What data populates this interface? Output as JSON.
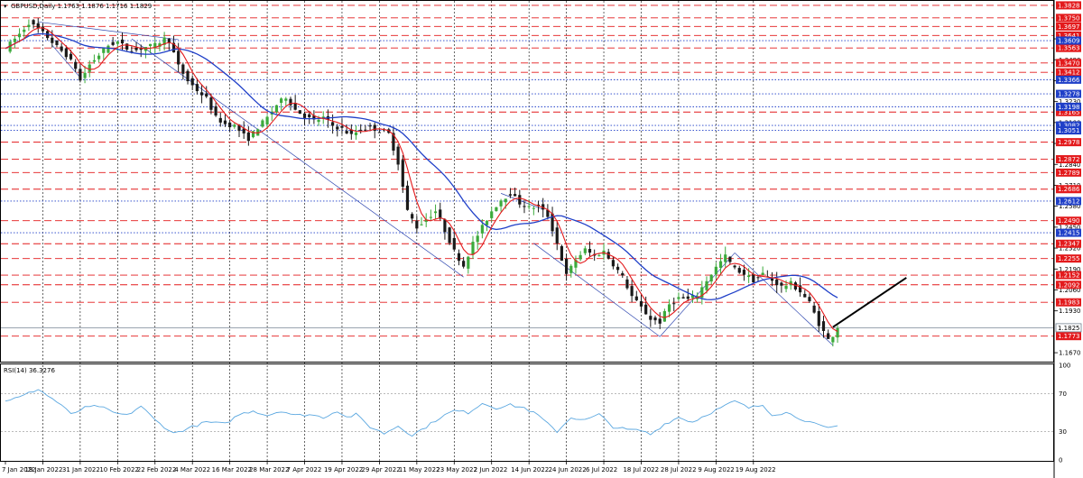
{
  "header": {
    "symbol_info": "GBPUSD,Daily  1.1763 1.1876 1.1716 1.1829",
    "rsi_title": "RSI(14) 36.3276"
  },
  "colors": {
    "bull": "#3caa3c",
    "bear": "#1a1a1a",
    "ma_fast": "#e31a1c",
    "ma_slow": "#1f3fc8",
    "resistance": "#e31a1c",
    "support_dotted": "#1f3fc8",
    "rsi_line": "#5aa7e0",
    "current_price": "#5f6f80"
  },
  "chart_data": {
    "type": "candlestick",
    "ylim": [
      1.162,
      1.385
    ],
    "price_axis_ticks": [
      "1.1670",
      "1.1930",
      "1.2060",
      "1.2190",
      "1.2320",
      "1.2450",
      "1.2580",
      "1.2710",
      "1.2840",
      "1.2970",
      "1.3100",
      "1.3230",
      "1.3360",
      "1.3490",
      "1.3620"
    ],
    "date_labels": [
      "7 Jan 2022",
      "19 Jan 2022",
      "31 Jan 2022",
      "10 Feb 2022",
      "22 Feb 2022",
      "4 Mar 2022",
      "16 Mar 2022",
      "28 Mar 2022",
      "7 Apr 2022",
      "19 Apr 2022",
      "29 Apr 2022",
      "11 May 2022",
      "23 May 2022",
      "2 Jun 2022",
      "14 Jun 2022",
      "24 Jun 2022",
      "6 Jul 2022",
      "18 Jul 2022",
      "28 Jul 2022",
      "9 Aug 2022",
      "19 Aug 2022"
    ],
    "current_price": "1.1825",
    "red_levels": [
      "1.3828",
      "1.3750",
      "1.3697",
      "1.3641",
      "1.3563",
      "1.3470",
      "1.3412",
      "1.3165",
      "1.2978",
      "1.2872",
      "1.2789",
      "1.2686",
      "1.2490",
      "1.2347",
      "1.2255",
      "1.2152",
      "1.2092",
      "1.1983",
      "1.1773"
    ],
    "blue_levels": [
      "1.3609",
      "1.3366",
      "1.3278",
      "1.3198",
      "1.3082",
      "1.3051",
      "1.2612",
      "1.2415"
    ],
    "rsi": {
      "title": "RSI(14) 36.3276",
      "ylim": [
        0,
        100
      ],
      "ticks": [
        "100",
        "70",
        "30",
        "0"
      ],
      "levels": [
        70,
        30
      ],
      "anchors": [
        [
          0,
          63
        ],
        [
          3,
          66
        ],
        [
          7,
          75
        ],
        [
          9,
          68
        ],
        [
          12,
          58
        ],
        [
          14,
          48
        ],
        [
          17,
          55
        ],
        [
          20,
          57
        ],
        [
          23,
          50
        ],
        [
          26,
          47
        ],
        [
          29,
          57
        ],
        [
          32,
          42
        ],
        [
          36,
          28
        ],
        [
          40,
          35
        ],
        [
          43,
          40
        ],
        [
          47,
          38
        ],
        [
          50,
          48
        ],
        [
          53,
          52
        ],
        [
          56,
          47
        ],
        [
          59,
          52
        ],
        [
          62,
          47
        ],
        [
          65,
          48
        ],
        [
          68,
          45
        ],
        [
          71,
          52
        ],
        [
          73,
          45
        ],
        [
          75,
          48
        ],
        [
          78,
          35
        ],
        [
          81,
          28
        ],
        [
          84,
          36
        ],
        [
          87,
          26
        ],
        [
          90,
          35
        ],
        [
          93,
          45
        ],
        [
          96,
          52
        ],
        [
          99,
          50
        ],
        [
          102,
          60
        ],
        [
          105,
          55
        ],
        [
          108,
          58
        ],
        [
          111,
          55
        ],
        [
          114,
          47
        ],
        [
          116,
          38
        ],
        [
          118,
          30
        ],
        [
          121,
          45
        ],
        [
          124,
          42
        ],
        [
          127,
          48
        ],
        [
          130,
          35
        ],
        [
          133,
          32
        ],
        [
          136,
          31
        ],
        [
          138,
          27
        ],
        [
          141,
          38
        ],
        [
          144,
          45
        ],
        [
          147,
          40
        ],
        [
          150,
          48
        ],
        [
          153,
          55
        ],
        [
          156,
          62
        ],
        [
          159,
          55
        ],
        [
          162,
          58
        ],
        [
          164,
          48
        ],
        [
          167,
          50
        ],
        [
          170,
          44
        ],
        [
          173,
          38
        ],
        [
          176,
          33
        ],
        [
          178,
          36
        ]
      ]
    },
    "price_anchors": [
      [
        0,
        1.356
      ],
      [
        3,
        1.365
      ],
      [
        5,
        1.372
      ],
      [
        7,
        1.368
      ],
      [
        9,
        1.363
      ],
      [
        11,
        1.357
      ],
      [
        13,
        1.352
      ],
      [
        15,
        1.344
      ],
      [
        16,
        1.336
      ],
      [
        18,
        1.346
      ],
      [
        20,
        1.352
      ],
      [
        22,
        1.358
      ],
      [
        24,
        1.36
      ],
      [
        26,
        1.356
      ],
      [
        28,
        1.355
      ],
      [
        30,
        1.357
      ],
      [
        32,
        1.358
      ],
      [
        34,
        1.362
      ],
      [
        35,
        1.361
      ],
      [
        37,
        1.345
      ],
      [
        39,
        1.336
      ],
      [
        41,
        1.33
      ],
      [
        43,
        1.325
      ],
      [
        45,
        1.313
      ],
      [
        47,
        1.309
      ],
      [
        49,
        1.308
      ],
      [
        51,
        1.302
      ],
      [
        52,
        1.3
      ],
      [
        54,
        1.307
      ],
      [
        56,
        1.313
      ],
      [
        58,
        1.321
      ],
      [
        60,
        1.326
      ],
      [
        62,
        1.318
      ],
      [
        64,
        1.314
      ],
      [
        66,
        1.311
      ],
      [
        68,
        1.313
      ],
      [
        70,
        1.308
      ],
      [
        72,
        1.306
      ],
      [
        74,
        1.302
      ],
      [
        76,
        1.306
      ],
      [
        78,
        1.307
      ],
      [
        80,
        1.305
      ],
      [
        82,
        1.303
      ],
      [
        84,
        1.285
      ],
      [
        86,
        1.255
      ],
      [
        88,
        1.245
      ],
      [
        90,
        1.25
      ],
      [
        92,
        1.255
      ],
      [
        94,
        1.243
      ],
      [
        96,
        1.23
      ],
      [
        98,
        1.221
      ],
      [
        100,
        1.235
      ],
      [
        102,
        1.245
      ],
      [
        104,
        1.255
      ],
      [
        106,
        1.262
      ],
      [
        108,
        1.266
      ],
      [
        110,
        1.26
      ],
      [
        112,
        1.257
      ],
      [
        114,
        1.258
      ],
      [
        116,
        1.252
      ],
      [
        118,
        1.235
      ],
      [
        120,
        1.215
      ],
      [
        122,
        1.225
      ],
      [
        124,
        1.231
      ],
      [
        126,
        1.227
      ],
      [
        128,
        1.23
      ],
      [
        130,
        1.222
      ],
      [
        132,
        1.214
      ],
      [
        134,
        1.202
      ],
      [
        136,
        1.195
      ],
      [
        138,
        1.188
      ],
      [
        140,
        1.186
      ],
      [
        142,
        1.197
      ],
      [
        144,
        1.201
      ],
      [
        146,
        1.2
      ],
      [
        148,
        1.203
      ],
      [
        150,
        1.212
      ],
      [
        152,
        1.22
      ],
      [
        154,
        1.227
      ],
      [
        156,
        1.219
      ],
      [
        158,
        1.216
      ],
      [
        160,
        1.212
      ],
      [
        162,
        1.216
      ],
      [
        164,
        1.212
      ],
      [
        166,
        1.208
      ],
      [
        168,
        1.21
      ],
      [
        170,
        1.205
      ],
      [
        172,
        1.198
      ],
      [
        174,
        1.185
      ],
      [
        176,
        1.175
      ],
      [
        177,
        1.178
      ],
      [
        178,
        1.183
      ]
    ],
    "sma_fast_period": 5,
    "sma_slow_period": 20,
    "trendlines": [
      {
        "from": [
          7,
          1.3725
        ],
        "to": [
          37,
          1.3615
        ]
      },
      {
        "from": [
          10,
          1.358
        ],
        "to": [
          16,
          1.338
        ]
      },
      {
        "from": [
          27,
          1.362
        ],
        "to": [
          98,
          1.214
        ]
      },
      {
        "from": [
          106,
          1.266
        ],
        "to": [
          115,
          1.256
        ]
      },
      {
        "from": [
          113,
          1.235
        ],
        "to": [
          140,
          1.177
        ]
      },
      {
        "from": [
          140,
          1.177
        ],
        "to": [
          156,
          1.229
        ]
      },
      {
        "from": [
          156,
          1.229
        ],
        "to": [
          177,
          1.1716
        ]
      }
    ],
    "forecast_arrow": {
      "from": [
        177,
        1.1829
      ],
      "to": [
        185,
        1.208
      ]
    }
  }
}
